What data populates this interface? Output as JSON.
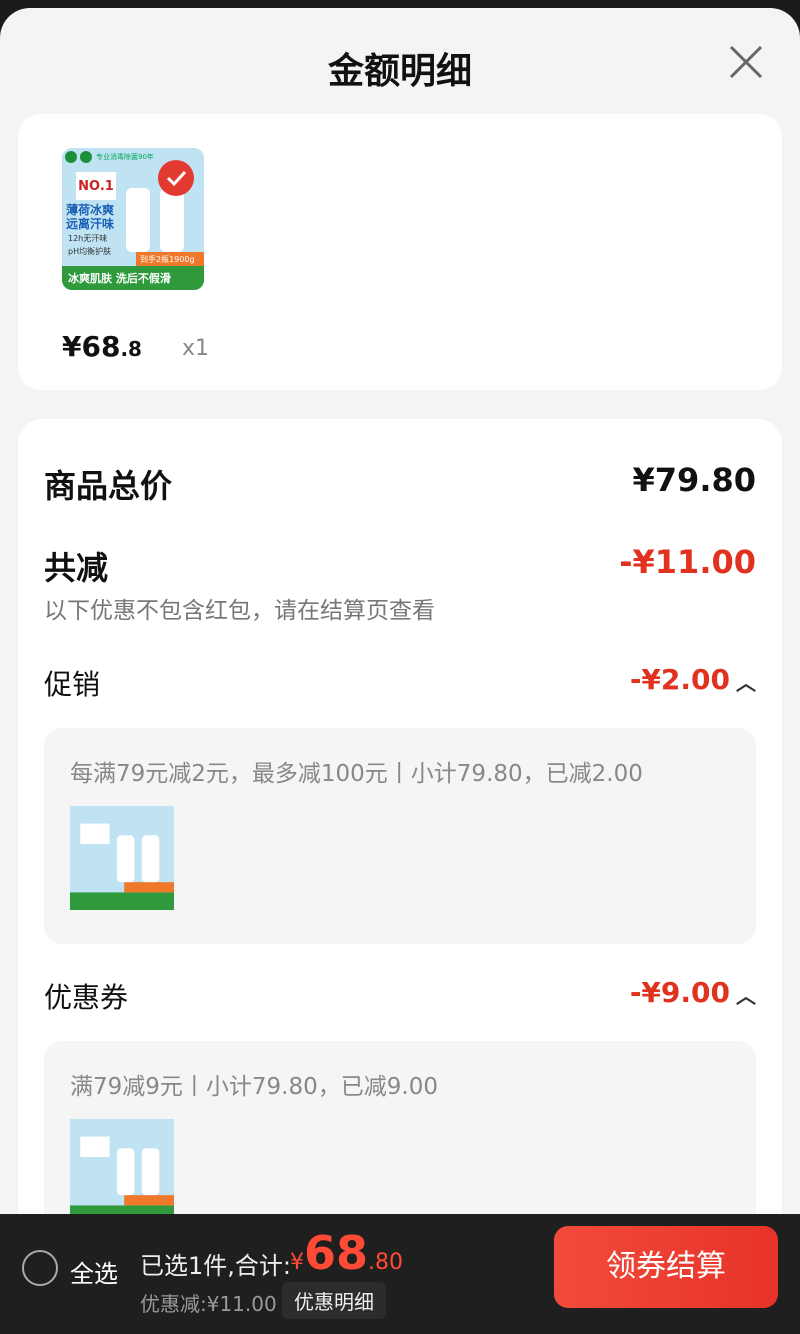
{
  "header": {
    "title": "金额明细"
  },
  "product": {
    "image_alt": "Dettol body wash pack",
    "image_texts": {
      "no1": "NO.1",
      "tagline": "专业消毒除菌90年",
      "headline_1": "薄荷冰爽",
      "headline_2": "远离汗味",
      "feat_1": "12h无汗味",
      "feat_2": "pH均衡护肤",
      "promo": "到手2瓶1900g",
      "footer": "冰爽肌肤 洗后不假滑"
    },
    "price_main": "¥68",
    "price_decimal": ".8",
    "quantity": "x1"
  },
  "summary": {
    "total_label": "商品总价",
    "total_value": "¥79.80",
    "reduce_label": "共减",
    "reduce_value": "-¥11.00",
    "note": "以下优惠不包含红包，请在结算页查看"
  },
  "promotion": {
    "label": "促销",
    "value": "-¥2.00",
    "detail": "每满79元减2元，最多减100元丨小计79.80，已减2.00"
  },
  "coupon": {
    "label": "优惠券",
    "value": "-¥9.00",
    "detail": "满79减9元丨小计79.80，已减9.00"
  },
  "bottom_bar": {
    "select_all": "全选",
    "selected_text": "已选1件,合计:",
    "total_symbol": "¥",
    "total_int": "68",
    "total_dec": ".80",
    "discount_text": "优惠减:¥11.00",
    "detail_button": "优惠明细",
    "checkout_button": "领券结算"
  },
  "colors": {
    "accent_red": "#e0321e",
    "checkout_red": "#f14b3a"
  }
}
